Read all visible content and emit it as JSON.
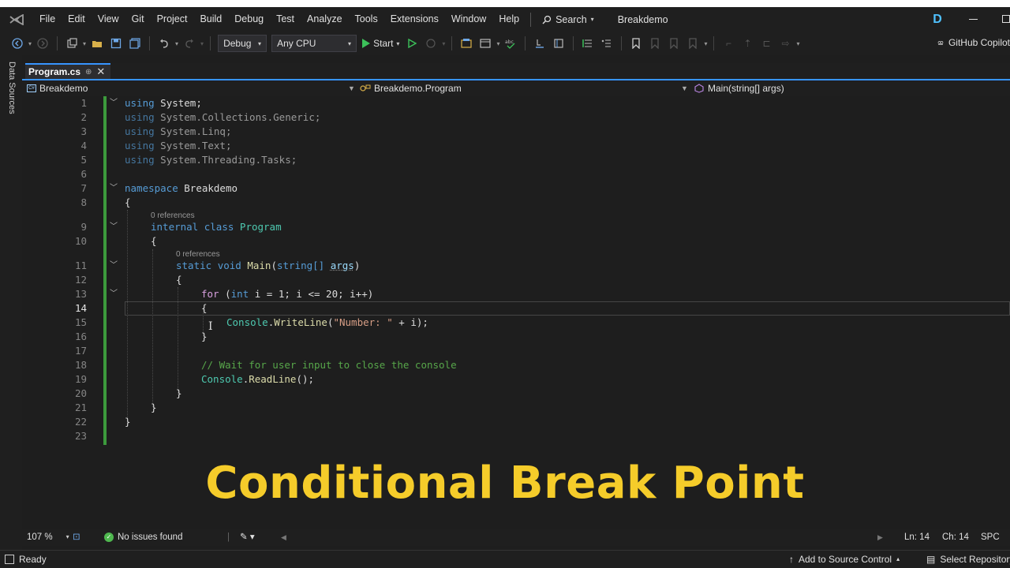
{
  "menubar": {
    "items": [
      "File",
      "Edit",
      "View",
      "Git",
      "Project",
      "Build",
      "Debug",
      "Test",
      "Analyze",
      "Tools",
      "Extensions",
      "Window",
      "Help"
    ],
    "search_label": "Search",
    "solution_name": "Breakdemo",
    "avatar_letter": "D"
  },
  "toolbar": {
    "config_value": "Debug",
    "platform_value": "Any CPU",
    "start_label": "Start",
    "copilot_label": "GitHub Copilot"
  },
  "siderail": {
    "label": "Data Sources"
  },
  "tab": {
    "title": "Program.cs",
    "pin": "⊕",
    "close": "✕"
  },
  "navbar": {
    "project": "Breakdemo",
    "class": "Breakdemo.Program",
    "member": "Main(string[] args)"
  },
  "editor": {
    "lines": [
      "1",
      "2",
      "3",
      "4",
      "5",
      "6",
      "7",
      "8",
      "9",
      "10",
      "11",
      "12",
      "13",
      "14",
      "15",
      "16",
      "17",
      "18",
      "19",
      "20",
      "21",
      "22",
      "23"
    ],
    "current_line": "14",
    "codelens_class": "0 references",
    "codelens_method": "0 references"
  },
  "code": {
    "using": "using",
    "ns1": "System",
    "ns2": "System.Collections.Generic",
    "ns3": "System.Linq",
    "ns4": "System.Text",
    "ns5": "System.Threading.Tasks",
    "namespace_kw": "namespace",
    "namespace_name": "Breakdemo",
    "internal_kw": "internal",
    "class_kw": "class",
    "class_name": "Program",
    "static_kw": "static",
    "void_kw": "void",
    "main_name": "Main",
    "string_kw": "string[]",
    "args": "args",
    "for_kw": "for",
    "int_kw": "int",
    "loop_rest": "i = 1; i <= 20; i++)",
    "console": "Console",
    "writeline": "WriteLine",
    "str_number": "\"Number: \"",
    "plus_i": " + i);",
    "comment": "// Wait for user input to close the console",
    "readline": "ReadLine",
    "readline_rest": "();"
  },
  "overlay": {
    "title": "Conditional Break Point"
  },
  "editor_status": {
    "zoom": "107 %",
    "issues": "No issues found",
    "line": "Ln: 14",
    "col": "Ch: 14",
    "spc": "SPC"
  },
  "statusbar": {
    "ready": "Ready",
    "source_control": "Add to Source Control",
    "repository": "Select Repository"
  },
  "colors": {
    "accent": "#3794ff",
    "overlay_text": "#f5cc2a",
    "change_bar": "#3c9a3c",
    "start_green": "#3cc15a"
  }
}
